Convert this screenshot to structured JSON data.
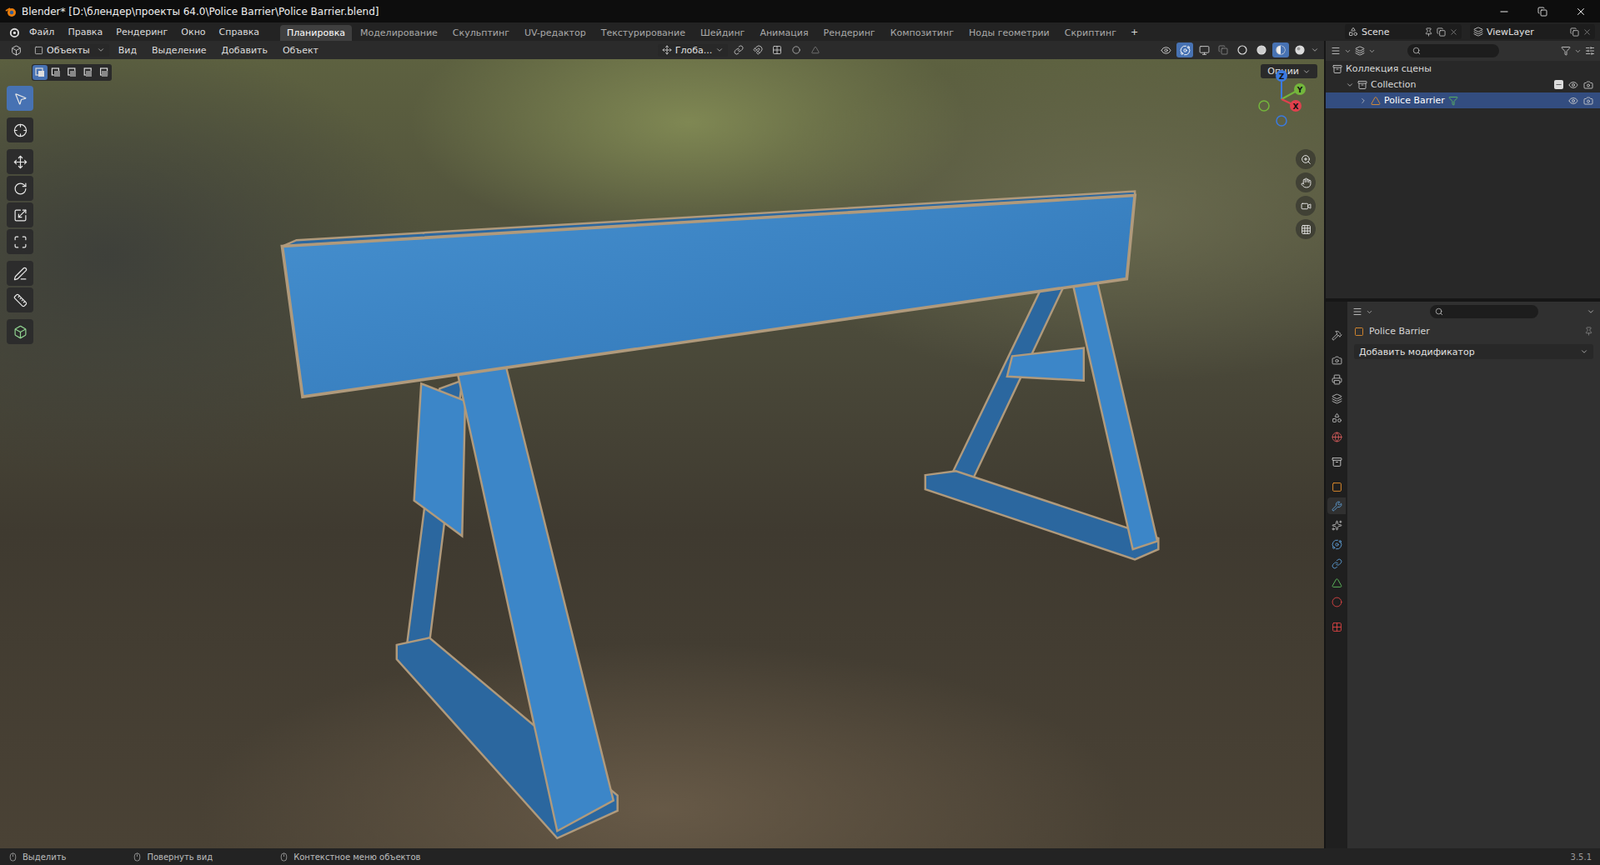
{
  "window": {
    "title": "Blender* [D:\\блендер\\проекты 64.0\\Police Barrier\\Police Barrier.blend]"
  },
  "menu": [
    "Файл",
    "Правка",
    "Рендеринг",
    "Окно",
    "Справка"
  ],
  "workspaces": [
    {
      "label": "Планировка",
      "selected": true
    },
    {
      "label": "Моделирование",
      "selected": false
    },
    {
      "label": "Скульптинг",
      "selected": false
    },
    {
      "label": "UV-редактор",
      "selected": false
    },
    {
      "label": "Текстурирование",
      "selected": false
    },
    {
      "label": "Шейдинг",
      "selected": false
    },
    {
      "label": "Анимация",
      "selected": false
    },
    {
      "label": "Рендеринг",
      "selected": false
    },
    {
      "label": "Композитинг",
      "selected": false
    },
    {
      "label": "Ноды геометрии",
      "selected": false
    },
    {
      "label": "Скриптинг",
      "selected": false
    }
  ],
  "add_workspace": "+",
  "scene": "Scene",
  "view_layer": "ViewLayer",
  "viewport_header": {
    "mode": "Объекты",
    "menus": [
      "Вид",
      "Выделение",
      "Добавить",
      "Объект"
    ],
    "orientation": "Глоба...",
    "gizmo_on": true,
    "shading_modes": [
      {
        "selected": false
      },
      {
        "selected": false
      },
      {
        "selected": true
      },
      {
        "selected": false
      }
    ]
  },
  "viewport": {
    "options": "Опции",
    "select_modes": [
      {
        "selected": true
      },
      {
        "selected": false
      },
      {
        "selected": false
      },
      {
        "selected": false
      },
      {
        "selected": false
      }
    ],
    "tools": [
      {
        "selected": true
      },
      {
        "selected": false
      },
      {
        "selected": false
      },
      {
        "selected": false
      },
      {
        "selected": false
      },
      {
        "selected": false
      },
      {
        "selected": false
      },
      {
        "selected": false
      },
      {
        "selected": false
      }
    ],
    "gizmo_axes": [
      {
        "label": "Z",
        "color": "#3b7ae0"
      },
      {
        "label": "Y",
        "color": "#74b63c"
      },
      {
        "label": "X",
        "color": "#e0404e"
      }
    ]
  },
  "outliner": {
    "items": [
      {
        "label": "Коллекция сцены",
        "kind": "scene",
        "depth": 0,
        "expanded": true,
        "selected": false
      },
      {
        "label": "Collection",
        "kind": "collection",
        "depth": 1,
        "expanded": true,
        "selected": false,
        "checked": true
      },
      {
        "label": "Police Barrier",
        "kind": "object",
        "depth": 2,
        "expanded": false,
        "selected": true
      }
    ]
  },
  "properties": {
    "object": "Police Barrier",
    "add_modifier": "Добавить модификатор",
    "tabs": [
      {
        "selected": false
      },
      {
        "selected": false
      },
      {
        "selected": false
      },
      {
        "selected": false
      },
      {
        "selected": false
      },
      {
        "selected": false
      },
      {
        "selected": false
      },
      {
        "selected": false
      },
      {
        "selected": true
      },
      {
        "selected": false
      },
      {
        "selected": false
      },
      {
        "selected": false
      },
      {
        "selected": false
      },
      {
        "selected": false
      },
      {
        "selected": false
      }
    ]
  },
  "status_bar": {
    "items": [
      "Выделить",
      "Повернуть вид",
      "Контекстное меню объектов"
    ],
    "version": "3.5.1"
  }
}
